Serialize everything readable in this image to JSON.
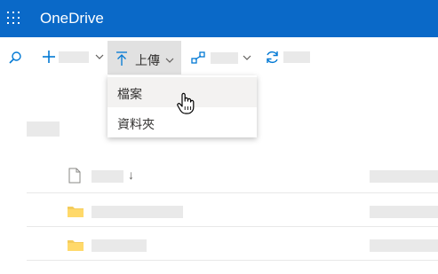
{
  "app": {
    "title": "OneDrive"
  },
  "toolbar": {
    "new_label": "",
    "upload_label": "上傳",
    "share_label": "",
    "sync_label": ""
  },
  "upload_menu": {
    "items": [
      {
        "label": "檔案"
      },
      {
        "label": "資料夾"
      }
    ]
  },
  "file_list": {
    "sort_arrow": "↓",
    "rows": [
      {
        "type": "file-header",
        "icon": "document-icon"
      },
      {
        "type": "folder",
        "icon": "folder-icon"
      },
      {
        "type": "folder",
        "icon": "folder-icon"
      }
    ]
  },
  "colors": {
    "brand": "#0a69c8",
    "accent": "#0078d4",
    "folder": "#f4cc5c",
    "hover": "#e1e1e1"
  }
}
